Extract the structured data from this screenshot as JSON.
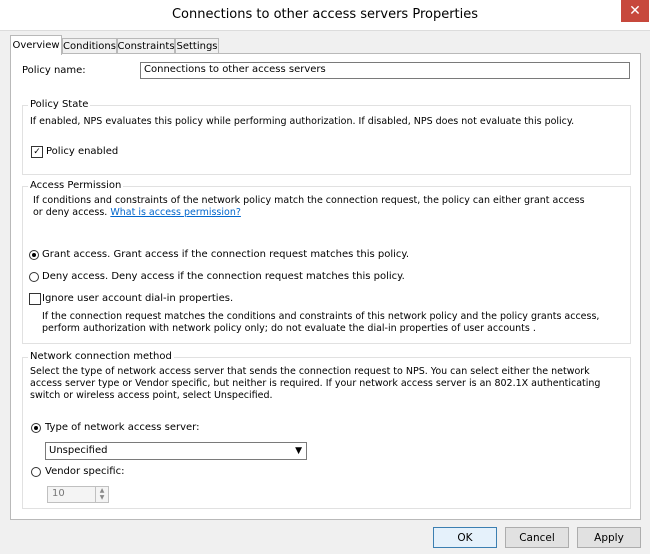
{
  "window": {
    "title": "Connections to other access servers Properties",
    "close_glyph": "✕"
  },
  "tabs": [
    "Overview",
    "Conditions",
    "Constraints",
    "Settings"
  ],
  "policy_name": {
    "label": "Policy name:",
    "value": "Connections to other access servers"
  },
  "policy_state": {
    "title": "Policy State",
    "description": "If enabled, NPS evaluates this policy while performing authorization. If disabled, NPS does not evaluate this policy.",
    "enabled_label": "Policy enabled",
    "enabled_checked": true
  },
  "access_permission": {
    "title": "Access Permission",
    "description": "If conditions and constraints of the network policy match the connection request, the policy can either grant access or deny access.",
    "link_text": "What is access permission?",
    "grant_label": "Grant access. Grant access if the connection request matches this policy.",
    "deny_label": "Deny access. Deny access if the connection request matches this policy.",
    "selected": "grant",
    "ignore_label": "Ignore user account dial-in properties.",
    "ignore_checked": false,
    "ignore_description": "If the connection request matches the conditions and constraints of this network policy and the policy grants access, perform authorization with network policy only; do not evaluate the dial-in properties of user accounts ."
  },
  "network_method": {
    "title": "Network connection method",
    "description": "Select the type of network access server that sends the connection request to NPS. You can select either the network access server type or Vendor specific, but neither is required.  If your network access server is an 802.1X authenticating switch or wireless access point, select Unspecified.",
    "type_label": "Type of network access server:",
    "type_value": "Unspecified",
    "vendor_label": "Vendor specific:",
    "vendor_value": "10",
    "selected": "type"
  },
  "buttons": {
    "ok": "OK",
    "cancel": "Cancel",
    "apply": "Apply"
  }
}
